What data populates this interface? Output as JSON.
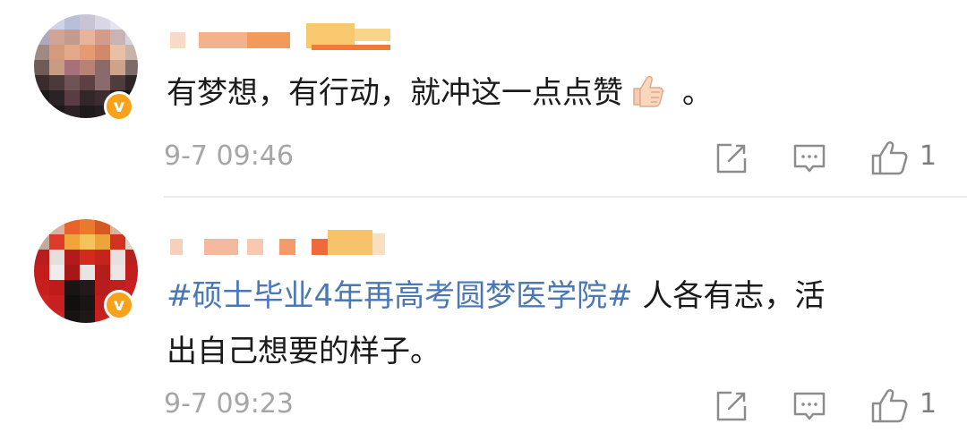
{
  "comments": [
    {
      "avatar": "pixelated-avatar",
      "verified_mark": "v",
      "text": "有梦想，有行动，就冲这一点点赞",
      "emoji": "thumbs-up-emoji",
      "trailing": "。",
      "time": "9-7 09:46",
      "likes": "1",
      "icons": {
        "share": "share-icon",
        "comment": "comment-icon",
        "like": "like-icon"
      }
    },
    {
      "avatar": "pixelated-avatar",
      "verified_mark": "v",
      "hashtag": "#硕士毕业4年再高考圆梦医学院#",
      "text_line1": " 人各有志，活",
      "text_line2": "出自己想要的样子。",
      "time": "9-7 09:23",
      "likes": "1",
      "icons": {
        "share": "share-icon",
        "comment": "comment-icon",
        "like": "like-icon"
      }
    }
  ],
  "colors": {
    "hashtag": "#4a77b5",
    "text": "#1b1b1b",
    "meta": "#a6a6a6",
    "icon": "#8c8c8c",
    "verified": "#f6a21a",
    "divider": "#ebebeb"
  }
}
